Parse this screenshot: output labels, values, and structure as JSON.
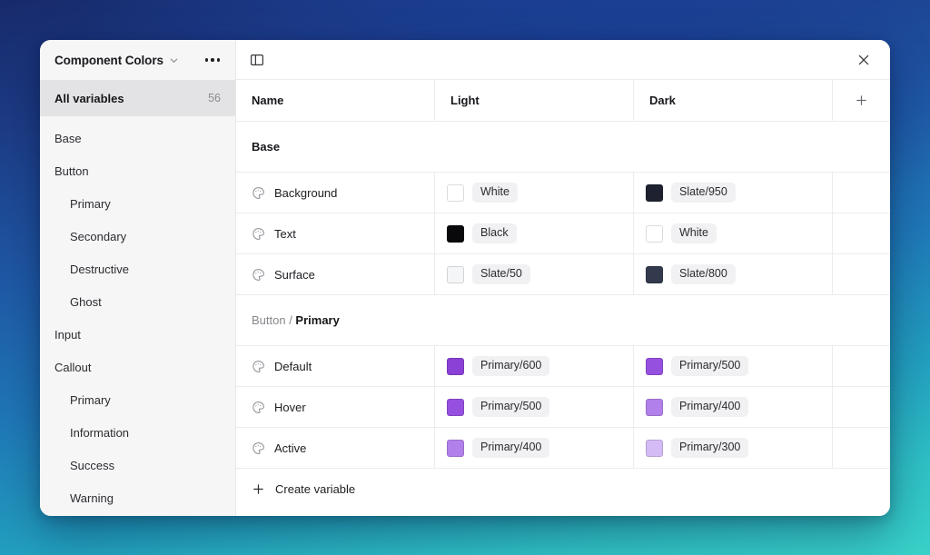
{
  "background": {
    "gradient_top": "#172a6b",
    "gradient_mid": "#1f78b8",
    "gradient_bottom": "#39d2c9"
  },
  "sidebar": {
    "file_title": "Component Colors",
    "chevron_icon": "chevron-down-icon",
    "more_icon": "more-options-icon",
    "all_variables": {
      "label": "All variables",
      "count": "56"
    },
    "items": [
      {
        "label": "Base",
        "level": 0
      },
      {
        "label": "Button",
        "level": 0
      },
      {
        "label": "Primary",
        "level": 1
      },
      {
        "label": "Secondary",
        "level": 1
      },
      {
        "label": "Destructive",
        "level": 1
      },
      {
        "label": "Ghost",
        "level": 1
      },
      {
        "label": "Input",
        "level": 0
      },
      {
        "label": "Callout",
        "level": 0
      },
      {
        "label": "Primary",
        "level": 1
      },
      {
        "label": "Information",
        "level": 1
      },
      {
        "label": "Success",
        "level": 1
      },
      {
        "label": "Warning",
        "level": 1
      }
    ]
  },
  "toolbar": {
    "panel_toggle_icon": "panel-toggle-icon",
    "close_icon": "close-icon"
  },
  "table": {
    "columns": [
      {
        "label": "Name"
      },
      {
        "label": "Light"
      },
      {
        "label": "Dark"
      }
    ],
    "add_column_icon": "plus-icon",
    "groups": [
      {
        "title": "Base",
        "title_prefix": "",
        "rows": [
          {
            "icon": "palette-icon",
            "name": "Background",
            "light": {
              "label": "White",
              "color": "#ffffff"
            },
            "dark": {
              "label": "Slate/950",
              "color": "#1e2230"
            }
          },
          {
            "icon": "palette-icon",
            "name": "Text",
            "light": {
              "label": "Black",
              "color": "#09090b"
            },
            "dark": {
              "label": "White",
              "color": "#ffffff"
            }
          },
          {
            "icon": "palette-icon",
            "name": "Surface",
            "light": {
              "label": "Slate/50",
              "color": "#f5f6f8"
            },
            "dark": {
              "label": "Slate/800",
              "color": "#333a4d"
            }
          }
        ]
      },
      {
        "title": "Primary",
        "title_prefix": "Button / ",
        "rows": [
          {
            "icon": "palette-icon",
            "name": "Default",
            "light": {
              "label": "Primary/600",
              "color": "#8b41d6"
            },
            "dark": {
              "label": "Primary/500",
              "color": "#9650e0"
            }
          },
          {
            "icon": "palette-icon",
            "name": "Hover",
            "light": {
              "label": "Primary/500",
              "color": "#9650e0"
            },
            "dark": {
              "label": "Primary/400",
              "color": "#b280ea"
            }
          },
          {
            "icon": "palette-icon",
            "name": "Active",
            "light": {
              "label": "Primary/400",
              "color": "#b280ea"
            },
            "dark": {
              "label": "Primary/300",
              "color": "#d4bbf5"
            }
          }
        ]
      }
    ],
    "create_variable": {
      "icon": "plus-icon",
      "label": "Create variable"
    }
  }
}
